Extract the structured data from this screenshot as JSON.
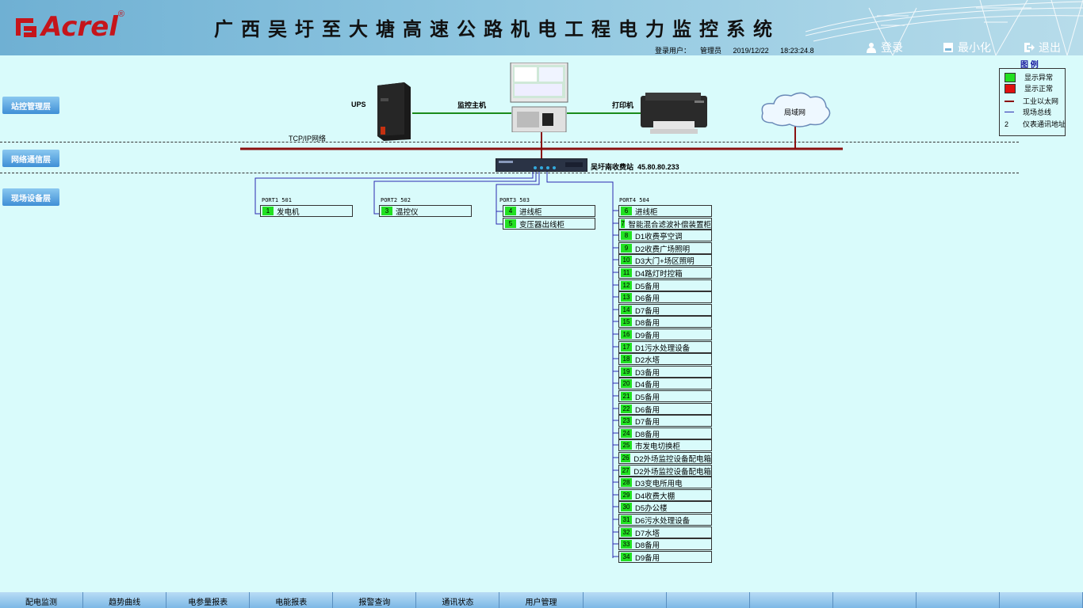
{
  "header": {
    "brand": "Acrel",
    "brand_mark": "®",
    "title": "广西吴圩至大塘高速公路机电工程电力监控系统",
    "login_user_label": "登录用户：",
    "login_user": "管理员",
    "date": "2019/12/22",
    "time": "18:23:24.8",
    "login_button": "登录",
    "minimize_button": "最小化",
    "exit_button": "退出"
  },
  "legend": {
    "title": "图 例",
    "items": [
      {
        "label": "显示异常",
        "symbol": "green-square",
        "color": "#22e022"
      },
      {
        "label": "显示正常",
        "symbol": "red-square",
        "color": "#e01010"
      },
      {
        "label": "工业以太网",
        "symbol": "dark-red-line",
        "color": "#8a1010"
      },
      {
        "label": "现场总线",
        "symbol": "blue-line",
        "color": "#2a2ab0"
      },
      {
        "label": "仪表通讯地址",
        "symbol": "2"
      }
    ]
  },
  "layers": [
    {
      "label": "站控管理层"
    },
    {
      "label": "网络通信层"
    },
    {
      "label": "现场设备层"
    }
  ],
  "topology": {
    "ups_label": "UPS",
    "host_label": "监控主机",
    "printer_label": "打印机",
    "lan_label": "局域网",
    "tcpip_label": "TCP/IP网络",
    "station_label": "吴圩南收费站",
    "station_ip": "45.80.80.233"
  },
  "ports": [
    {
      "label": "PORT1  501",
      "devices": [
        {
          "num": "1",
          "name": "发电机"
        }
      ]
    },
    {
      "label": "PORT2  502",
      "devices": [
        {
          "num": "3",
          "name": "温控仪"
        }
      ]
    },
    {
      "label": "PORT3  503",
      "devices": [
        {
          "num": "4",
          "name": "进线柜"
        },
        {
          "num": "5",
          "name": "变压器出线柜"
        }
      ]
    },
    {
      "label": "PORT4  504",
      "devices": [
        {
          "num": "6",
          "name": "进线柜"
        },
        {
          "num": "7",
          "name": "智能混合滤波补偿装置柜"
        },
        {
          "num": "8",
          "name": "D1收费亭空调"
        },
        {
          "num": "9",
          "name": "D2收费广场照明"
        },
        {
          "num": "10",
          "name": "D3大门+场区照明"
        },
        {
          "num": "11",
          "name": "D4路灯时控箱"
        },
        {
          "num": "12",
          "name": "D5备用"
        },
        {
          "num": "13",
          "name": "D6备用"
        },
        {
          "num": "14",
          "name": "D7备用"
        },
        {
          "num": "15",
          "name": "D8备用"
        },
        {
          "num": "16",
          "name": "D9备用"
        },
        {
          "num": "17",
          "name": "D1污水处理设备"
        },
        {
          "num": "18",
          "name": "D2水塔"
        },
        {
          "num": "19",
          "name": "D3备用"
        },
        {
          "num": "20",
          "name": "D4备用"
        },
        {
          "num": "21",
          "name": "D5备用"
        },
        {
          "num": "22",
          "name": "D6备用"
        },
        {
          "num": "23",
          "name": "D7备用"
        },
        {
          "num": "24",
          "name": "D8备用"
        },
        {
          "num": "25",
          "name": "市发电切换柜"
        },
        {
          "num": "26",
          "name": "D2外场监控设备配电箱"
        },
        {
          "num": "27",
          "name": "D2外场监控设备配电箱"
        },
        {
          "num": "28",
          "name": "D3变电所用电"
        },
        {
          "num": "29",
          "name": "D4收费大棚"
        },
        {
          "num": "30",
          "name": "D5办公楼"
        },
        {
          "num": "31",
          "name": "D6污水处理设备"
        },
        {
          "num": "32",
          "name": "D7水塔"
        },
        {
          "num": "33",
          "name": "D8备用"
        },
        {
          "num": "34",
          "name": "D9备用"
        }
      ]
    }
  ],
  "nav": [
    {
      "label": "配电监测"
    },
    {
      "label": "趋势曲线"
    },
    {
      "label": "电参量报表"
    },
    {
      "label": "电能报表"
    },
    {
      "label": "报警查询"
    },
    {
      "label": "通讯状态"
    },
    {
      "label": "用户管理"
    },
    {
      "label": ""
    },
    {
      "label": ""
    },
    {
      "label": ""
    },
    {
      "label": ""
    },
    {
      "label": ""
    },
    {
      "label": ""
    }
  ]
}
